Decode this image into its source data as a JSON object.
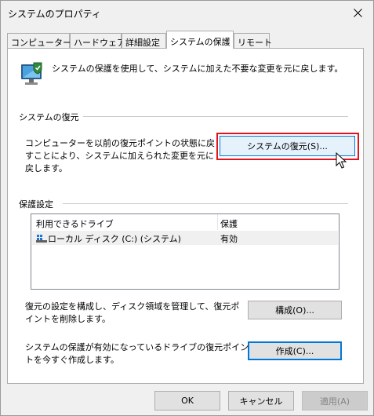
{
  "window": {
    "title": "システムのプロパティ"
  },
  "tabs": [
    {
      "label": "コンピューター名"
    },
    {
      "label": "ハードウェア"
    },
    {
      "label": "詳細設定"
    },
    {
      "label": "システムの保護"
    },
    {
      "label": "リモート"
    }
  ],
  "intro": {
    "text": "システムの保護を使用して、システムに加えた不要な変更を元に戻します。"
  },
  "restore_section": {
    "title": "システムの復元",
    "description": "コンピューターを以前の復元ポイントの状態に戻すことにより、システムに加えられた変更を元に戻します。",
    "button_label": "システムの復元(S)..."
  },
  "protection_section": {
    "title": "保護設定",
    "columns": {
      "drive": "利用できるドライブ",
      "status": "保護"
    },
    "drives": [
      {
        "name": "ローカル ディスク (C:) (システム)",
        "status": "有効"
      }
    ],
    "configure_text": "復元の設定を構成し、ディスク領域を管理して、復元ポイントを削除します。",
    "configure_button": "構成(O)...",
    "create_text": "システムの保護が有効になっているドライブの復元ポイントを今すぐ作成します。",
    "create_button": "作成(C)..."
  },
  "footer": {
    "ok": "OK",
    "cancel": "キャンセル",
    "apply": "適用(A)"
  },
  "colors": {
    "highlight": "#e0141e",
    "focus_border": "#0078d7"
  }
}
